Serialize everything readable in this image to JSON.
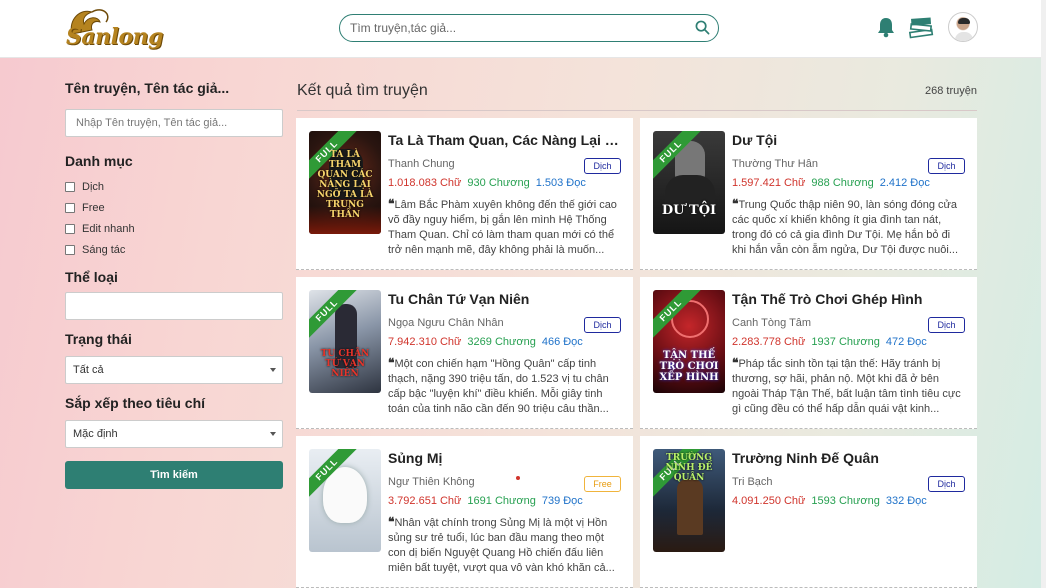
{
  "header": {
    "logo_text": "Sanlong",
    "search_placeholder": "Tìm truyện,tác giả..."
  },
  "sidebar": {
    "name_label": "Tên truyện, Tên tác giả...",
    "name_placeholder": "Nhập Tên truyện, Tên tác giả...",
    "category_label": "Danh mục",
    "categories": [
      "Dịch",
      "Free",
      "Edit nhanh",
      "Sáng tác"
    ],
    "genre_label": "Thể loại",
    "status_label": "Trạng thái",
    "status_value": "Tất cả",
    "sort_label": "Sắp xếp theo tiêu chí",
    "sort_value": "Mặc định",
    "search_button": "Tìm kiếm"
  },
  "main": {
    "title": "Kết quả tìm truyện",
    "count": "268 truyện",
    "books": [
      {
        "title": "Ta Là Tham Quan, Các Nàng Lại N...",
        "author": "Thanh Chung",
        "tag": "Dịch",
        "words": "1.018.083 Chữ",
        "chapters": "930 Chương",
        "reads": "1.503 Đọc",
        "desc": "Lâm Bắc Phàm xuyên không đến thế giới cao võ đầy nguy hiểm, bị gắn lên mình Hệ Thống Tham Quan. Chỉ có làm tham quan mới có thể trở nên mạnh mẽ, đây không phải là muốn...",
        "ribbon": "FULL",
        "cover_text": "TA LÀ THAM QUAN CÁC NÀNG LẠI NGỠ TA LÀ TRUNG THẦN"
      },
      {
        "title": "Dư Tội",
        "author": "Thường Thư Hân",
        "tag": "Dịch",
        "words": "1.597.421 Chữ",
        "chapters": "988 Chương",
        "reads": "2.412 Đọc",
        "desc": "Trung Quốc thập niên 90, làn sóng đóng cửa các quốc xí khiến không ít gia đình tan nát, trong đó có cả gia đình Dư Tội. Mẹ hắn bỏ đi khi hắn vẫn còn ẵm ngửa, Dư Tội được nuôi...",
        "ribbon": "FULL",
        "cover_text": "DƯ TỘI"
      },
      {
        "title": "Tu Chân Tứ Vạn Niên",
        "author": "Ngọa Ngưu Chân Nhân",
        "tag": "Dịch",
        "words": "7.942.310 Chữ",
        "chapters": "3269 Chương",
        "reads": "466 Đọc",
        "desc": "Một con chiến hạm \"Hồng Quân\" cấp tinh thạch, nặng 390 triệu tấn, do 1.523 vị tu chân cấp bậc \"luyện khí\" điều khiển. Mỗi giây tinh toán của tinh não cần đến 90 triệu câu thần...",
        "ribbon": "FULL",
        "cover_text": "TU CHÂN TỨ VẠN NIÊN"
      },
      {
        "title": "Tận Thế Trò Chơi Ghép Hình",
        "author": "Canh Tòng Tâm",
        "tag": "Dịch",
        "words": "2.283.778 Chữ",
        "chapters": "1937 Chương",
        "reads": "472 Đọc",
        "desc": "Pháp tắc sinh tồn tại tận thế: Hãy tránh bị thương, sợ hãi, phản nộ. Một khi đã ở bên ngoài Tháp Tận Thế, bất luận tâm tình tiêu cực gì cũng đều có thể hấp dẫn quái vật kinh...",
        "ribbon": "FULL",
        "cover_text": "TẬN THẾ TRÒ CHƠI XẾP HÌNH"
      },
      {
        "title": "Sủng Mị",
        "author": "Ngư Thiên Không",
        "tag": "Free",
        "words": "3.792.651 Chữ",
        "chapters": "1691 Chương",
        "reads": "739 Đọc",
        "desc": "Nhân vật chính trong Sủng Mị là một vị Hồn sủng sư trẻ tuổi, lúc ban đầu mang theo một con dị biến Nguyệt Quang Hồ chiến đấu liên miên bất tuyệt, vượt qua vô vàn khó khăn cả...",
        "ribbon": "FULL",
        "cover_text": ""
      },
      {
        "title": "Trường Ninh Đế Quân",
        "author": "Tri Bạch",
        "tag": "Dịch",
        "words": "4.091.250 Chữ",
        "chapters": "1593 Chương",
        "reads": "332 Đọc",
        "desc": "",
        "ribbon": "FULL",
        "cover_text": "TRƯỜNG NINH ĐẾ QUÂN"
      }
    ]
  },
  "colors": {
    "accent": "#2e7f73",
    "words": "#d0342c",
    "chapters": "#27a051",
    "reads": "#1f72c9",
    "tag_translated": "#1f2a9e",
    "tag_free": "#e89c10",
    "ribbon": "#2f9a36"
  },
  "icons": [
    "search-icon",
    "bell-icon",
    "books-icon",
    "avatar"
  ]
}
